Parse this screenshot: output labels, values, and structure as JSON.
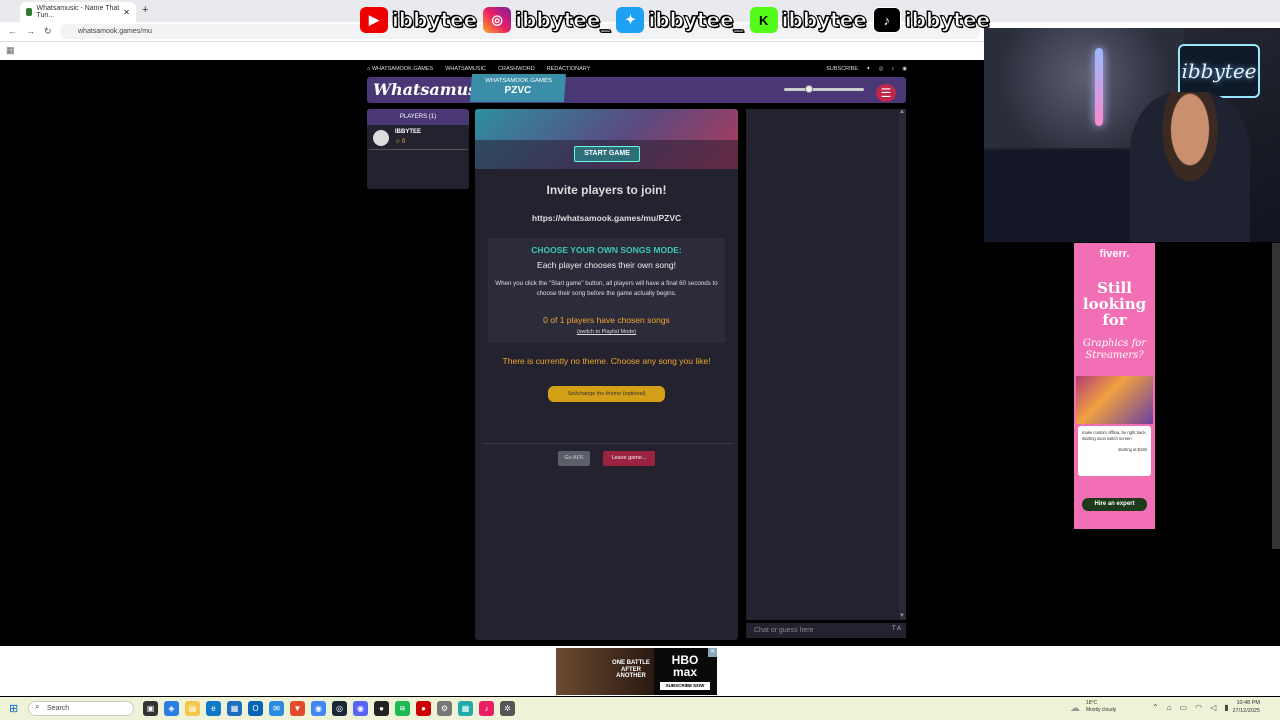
{
  "browser": {
    "tab_title": "Whatsamusic - Name That Tun...",
    "url": "whatsamook.games/mu"
  },
  "social": {
    "handles": [
      "ibbytee",
      "ibbytee_",
      "ibbytee_",
      "ibbytee",
      "ibbytee"
    ]
  },
  "topnav": {
    "home": "WHATSAMOOK.GAMES",
    "items": [
      "WHATSAMUSIC",
      "CRASHWORD",
      "REDACTIONARY"
    ],
    "subscribe": "SUBSCRIBE"
  },
  "header": {
    "logo": "Whatsamusic",
    "site_label": "WHATSAMOOK.GAMES",
    "room_code": "PZVC"
  },
  "players": {
    "heading": "PLAYERS (1)",
    "list": [
      {
        "name": "IBBYTEE",
        "score": "0"
      }
    ]
  },
  "main": {
    "start_button": "START GAME",
    "invite_title": "Invite players to join!",
    "invite_url": "https://whatsamook.games/mu/PZVC",
    "mode_title": "CHOOSE YOUR OWN SONGS MODE:",
    "mode_subtitle": "Each player chooses their own song!",
    "mode_desc": "When you click the \"Start game\" button, all players will have a final 60 seconds to choose their song before the game actually begins.",
    "chosen_count": "0 of 1 players have chosen songs",
    "switch_link": "(switch to Playlist Mode)",
    "theme_text": "There is currently no theme. Choose any song you like!",
    "theme_button": "Set/change the theme (optional)",
    "afk_button": "Go AFK",
    "leave_button": "Leave game..."
  },
  "chat": {
    "placeholder": "Chat or guess here",
    "lang": "T A"
  },
  "webcam": {
    "neon_sign": "ibbytee"
  },
  "fiverr_ad": {
    "logo": "fiverr.",
    "headline": "Still looking for",
    "subline": "Graphics for Streamers?",
    "card_text": "make custom offlina, be right back, starting soon twitch screen",
    "card_price": "starting at $150",
    "button": "Hire an expert"
  },
  "hbo_ad": {
    "movie": "ONE BATTLE AFTER ANOTHER",
    "logo": "HBO max",
    "cta": "SUBSCRIBE NOW"
  },
  "taskbar": {
    "search": "Search",
    "weather_temp": "18°C",
    "weather_desc": "Mostly cloudy",
    "time": "10:48 PM",
    "date": "27/12/2025"
  }
}
